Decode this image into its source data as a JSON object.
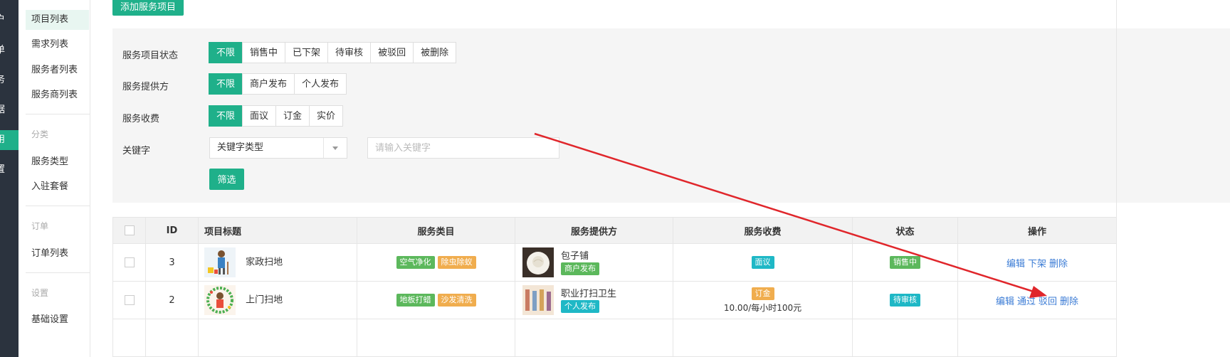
{
  "rail": {
    "items": [
      {
        "label": "户"
      },
      {
        "label": "单"
      },
      {
        "label": "务"
      },
      {
        "label": "据"
      },
      {
        "label": "用"
      },
      {
        "label": "置"
      }
    ],
    "active_color": "#1fb08a"
  },
  "subnav": {
    "items1": [
      "项目列表",
      "需求列表",
      "服务者列表",
      "服务商列表"
    ],
    "group2": "分类",
    "items2": [
      "服务类型",
      "入驻套餐"
    ],
    "group3": "订单",
    "items3": [
      "订单列表"
    ],
    "group4": "设置",
    "items4": [
      "基础设置"
    ]
  },
  "toolbar": {
    "add_label": "添加服务项目"
  },
  "filters": {
    "status": {
      "label": "服务项目状态",
      "options": [
        "不限",
        "销售中",
        "已下架",
        "待审核",
        "被驳回",
        "被删除"
      ]
    },
    "provider": {
      "label": "服务提供方",
      "options": [
        "不限",
        "商户发布",
        "个人发布"
      ]
    },
    "fee": {
      "label": "服务收费",
      "options": [
        "不限",
        "面议",
        "订金",
        "实价"
      ]
    },
    "keyword": {
      "label": "关键字",
      "select_value": "关键字类型",
      "placeholder": "请输入关键字"
    },
    "submit_label": "筛选"
  },
  "table": {
    "headers": [
      "ID",
      "项目标题",
      "服务类目",
      "服务提供方",
      "服务收费",
      "状态",
      "操作"
    ],
    "rows": [
      {
        "id": "3",
        "title": "家政扫地",
        "categories": [
          "空气净化",
          "除虫除蚁"
        ],
        "provider_name": "包子铺",
        "provider_type": "商户发布",
        "fee_badge": "面议",
        "fee_text": "",
        "status": "销售中",
        "actions": [
          "编辑",
          "下架",
          "删除"
        ]
      },
      {
        "id": "2",
        "title": "上门扫地",
        "categories": [
          "地板打蜡",
          "沙发清洗"
        ],
        "provider_name": "职业打扫卫生",
        "provider_type": "个人发布",
        "fee_badge": "订金",
        "fee_text": "10.00/每小时100元",
        "status": "待审核",
        "actions": [
          "编辑",
          "通过",
          "驳回",
          "删除"
        ]
      }
    ]
  },
  "colors": {
    "primary": "#1fb08a",
    "link": "#3a7bd5",
    "annotation": "#e0262b"
  }
}
